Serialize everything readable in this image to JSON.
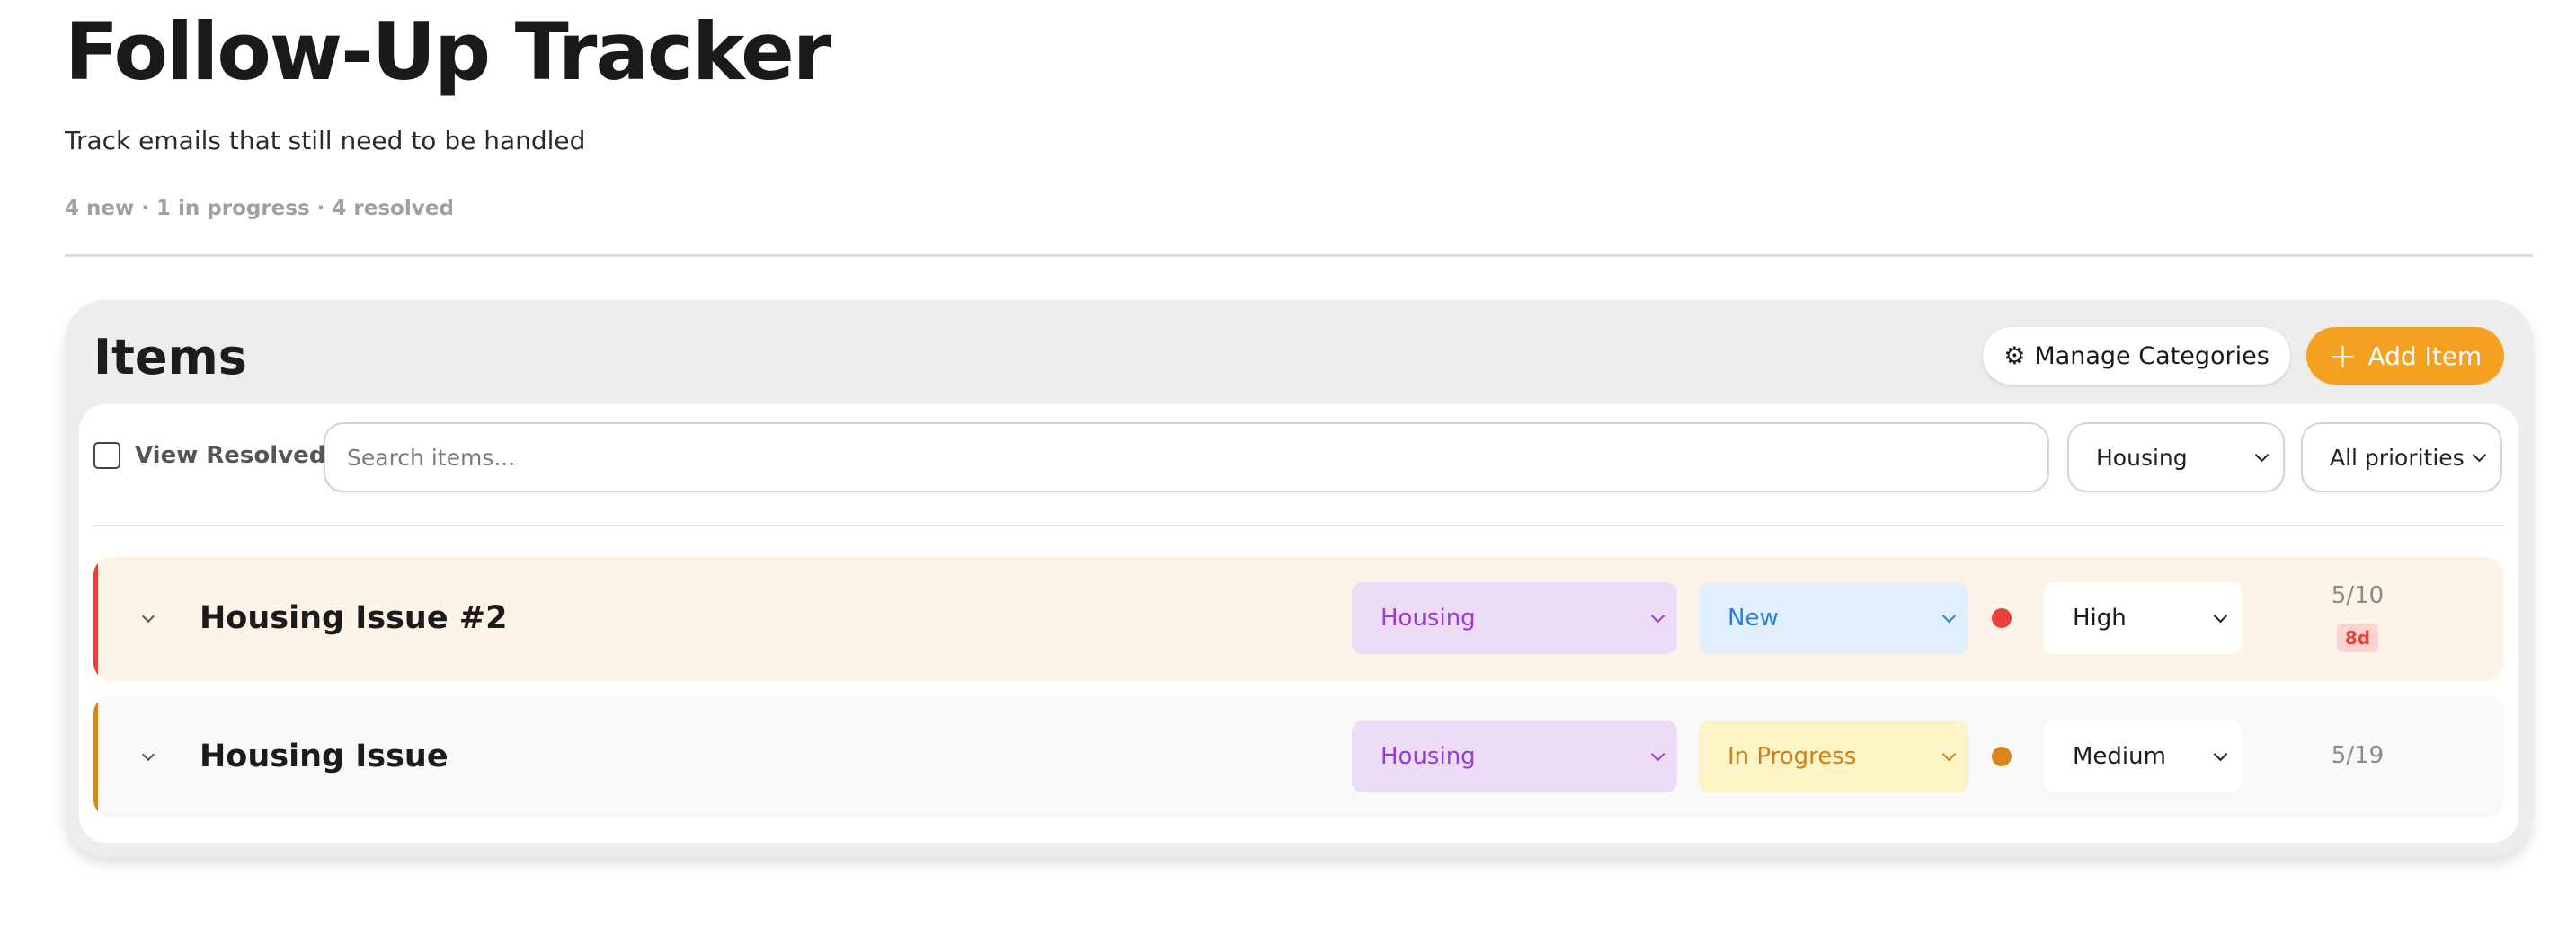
{
  "header": {
    "title": "Follow-Up Tracker",
    "subtitle": "Track emails that still need to be handled",
    "summary": "4 new · 1 in progress · 4 resolved"
  },
  "panel": {
    "title": "Items",
    "manage_button": {
      "icon": "gear-icon",
      "glyph": "⚙",
      "label": "Manage Categories"
    },
    "add_button": {
      "icon": "plus-icon",
      "glyph": "+",
      "label": "Add Item"
    }
  },
  "toolbar": {
    "view_resolved_label": "View Resolved",
    "view_resolved_checked": false,
    "search_placeholder": "Search items...",
    "category_filter": "Housing",
    "priority_filter": "All priorities"
  },
  "items": [
    {
      "title": "Housing Issue #2",
      "category": "Housing",
      "status": "New",
      "priority": "High",
      "date": "5/10",
      "age_badge": "8d"
    },
    {
      "title": "Housing Issue",
      "category": "Housing",
      "status": "In Progress",
      "priority": "Medium",
      "date": "5/19"
    }
  ],
  "colors": {
    "accent": "#f5a021",
    "high_priority": "#e8413a",
    "medium_priority": "#d8861a",
    "category_bg": "#ecdcf8",
    "category_text": "#9a3bd6",
    "status_new_bg": "#e1eefb",
    "status_new_text": "#2c7fd4",
    "status_progress_bg": "#fcf4c6",
    "status_progress_text": "#d0801a"
  }
}
